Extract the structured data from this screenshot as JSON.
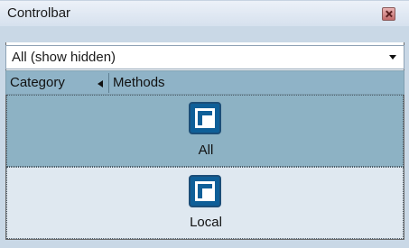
{
  "window": {
    "title": "Controlbar"
  },
  "dropdown": {
    "value": "All (show hidden)"
  },
  "header": {
    "category_label": "Category",
    "methods_label": "Methods"
  },
  "items": [
    {
      "label": "All",
      "icon": "window-icon",
      "selected": true
    },
    {
      "label": "Local",
      "icon": "window-icon",
      "selected": false
    }
  ],
  "colors": {
    "panel_bg": "#c9d8e6",
    "header_bg": "#8fb3c7",
    "selected_item_bg": "#8db2c4",
    "item_bg": "#dfe8f0",
    "icon_blue": "#0f5f98"
  }
}
